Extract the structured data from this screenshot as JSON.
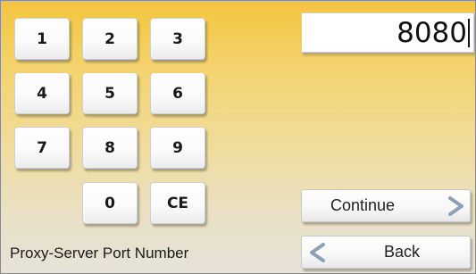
{
  "display": {
    "value": "8080"
  },
  "keypad": {
    "k1": "1",
    "k2": "2",
    "k3": "3",
    "k4": "4",
    "k5": "5",
    "k6": "6",
    "k7": "7",
    "k8": "8",
    "k9": "9",
    "k0": "0",
    "clear": "CE"
  },
  "buttons": {
    "continue": "Continue",
    "back": "Back"
  },
  "field_label": "Proxy-Server Port Number",
  "icons": {
    "continue": "chevron-right-icon",
    "back": "chevron-left-icon"
  },
  "colors": {
    "background_top": "#f3c43c",
    "background_bottom": "#e6e2d8",
    "chevron": "#8ea0b6"
  }
}
